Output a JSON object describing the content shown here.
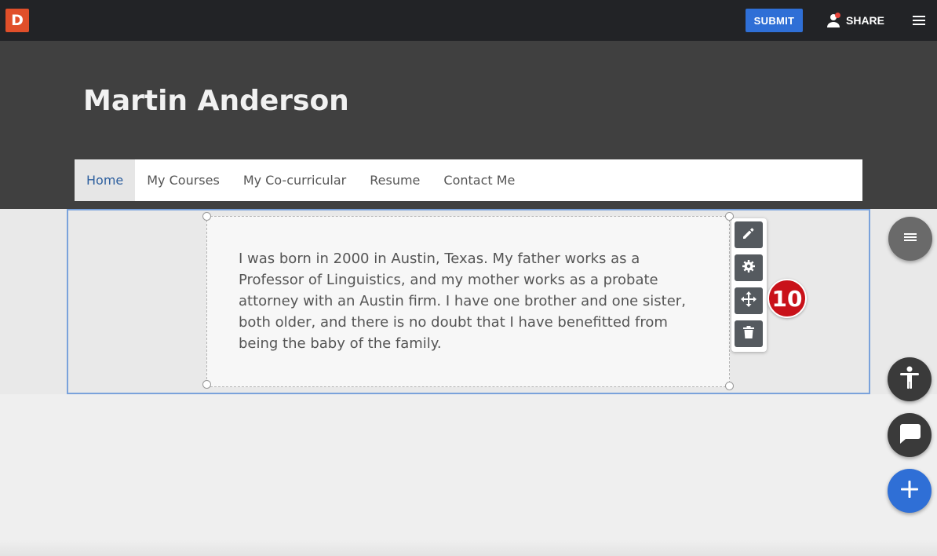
{
  "topbar": {
    "logo_text": "D",
    "submit_label": "SUBMIT",
    "share_label": "SHARE",
    "icons": {
      "user": "person-icon",
      "notify": "notification-dot",
      "menu": "hamburger-menu-icon"
    }
  },
  "header": {
    "title": "Martin Anderson"
  },
  "nav": {
    "items": [
      {
        "label": "Home",
        "active": true
      },
      {
        "label": "My Courses"
      },
      {
        "label": "My Co-curricular"
      },
      {
        "label": "Resume"
      },
      {
        "label": "Contact Me"
      }
    ]
  },
  "content": {
    "paragraph": "I was born in 2000 in Austin, Texas. My father works as a Professor of Linguistics, and my mother works as a probate attorney with an Austin firm. I have one brother and one sister, both older, and there is no doubt that I have benefitted from being the baby of the family."
  },
  "block_toolbar": {
    "tools": [
      "pencil-icon",
      "gear-icon",
      "move-icon",
      "trash-icon"
    ]
  },
  "badge": {
    "number": "10"
  },
  "fabs": [
    "section-menu-icon",
    "accessibility-icon",
    "chat-icon",
    "plus-icon"
  ],
  "colors": {
    "topbar": "#222326",
    "header": "#404040",
    "accent": "#2f6fd6",
    "logo": "#e04f2a",
    "badge": "#c9121a",
    "selection": "#7aa2db"
  }
}
